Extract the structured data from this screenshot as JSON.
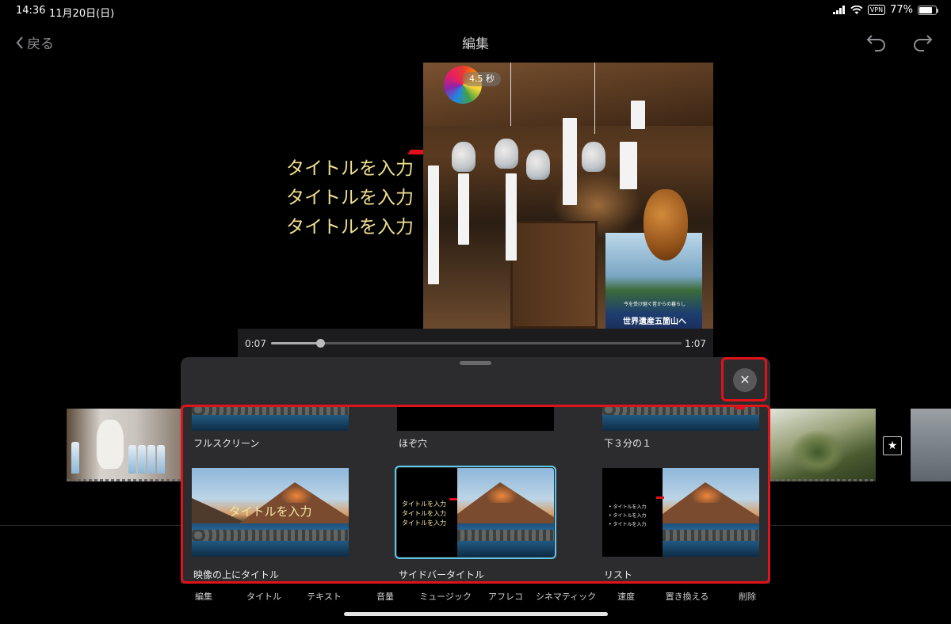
{
  "status_bar": {
    "time": "14:36",
    "date": "11月20日(日)",
    "vpn": "VPN",
    "battery": "77%"
  },
  "nav": {
    "back_label": "戻る",
    "title": "編集"
  },
  "viewer": {
    "title_lines": [
      "タイトルを入力",
      "タイトルを入力",
      "タイトルを入力"
    ],
    "duration_badge": "4.5 秒",
    "poster_small": "今を受け継ぐ昔からの暮らし",
    "poster_main": "世界遺産五箇山へ"
  },
  "scrubber": {
    "current": "0:07",
    "total": "1:07",
    "progress_fraction": 0.12
  },
  "title_styles": {
    "close_icon": "close-icon",
    "items": [
      {
        "label": "フルスクリーン"
      },
      {
        "label": "ほぞ穴"
      },
      {
        "label": "下３分の１"
      },
      {
        "label": "映像の上にタイトル",
        "preview_title": "タイトルを入力"
      },
      {
        "label": "サイドバータイトル",
        "preview_lines": [
          "タイトルを入力",
          "タイトルを入力",
          "タイトルを入力"
        ],
        "selected": true
      },
      {
        "label": "リスト",
        "preview_lines": [
          "• タイトルを入力",
          "• タイトルを入力",
          "• タイトルを入力"
        ]
      }
    ]
  },
  "toolbar": {
    "items": [
      "編集",
      "タイトル",
      "テキスト",
      "音量",
      "ミュージック",
      "アフレコ",
      "シネマティック",
      "速度",
      "置き換える",
      "削除"
    ]
  },
  "icons": {
    "favorite": "star-icon",
    "undo": "undo-icon",
    "redo": "redo-icon"
  },
  "colors": {
    "highlight_frame": "#e0121a",
    "selected_outline": "#5ec9ee",
    "title_text": "#f0e08e"
  }
}
